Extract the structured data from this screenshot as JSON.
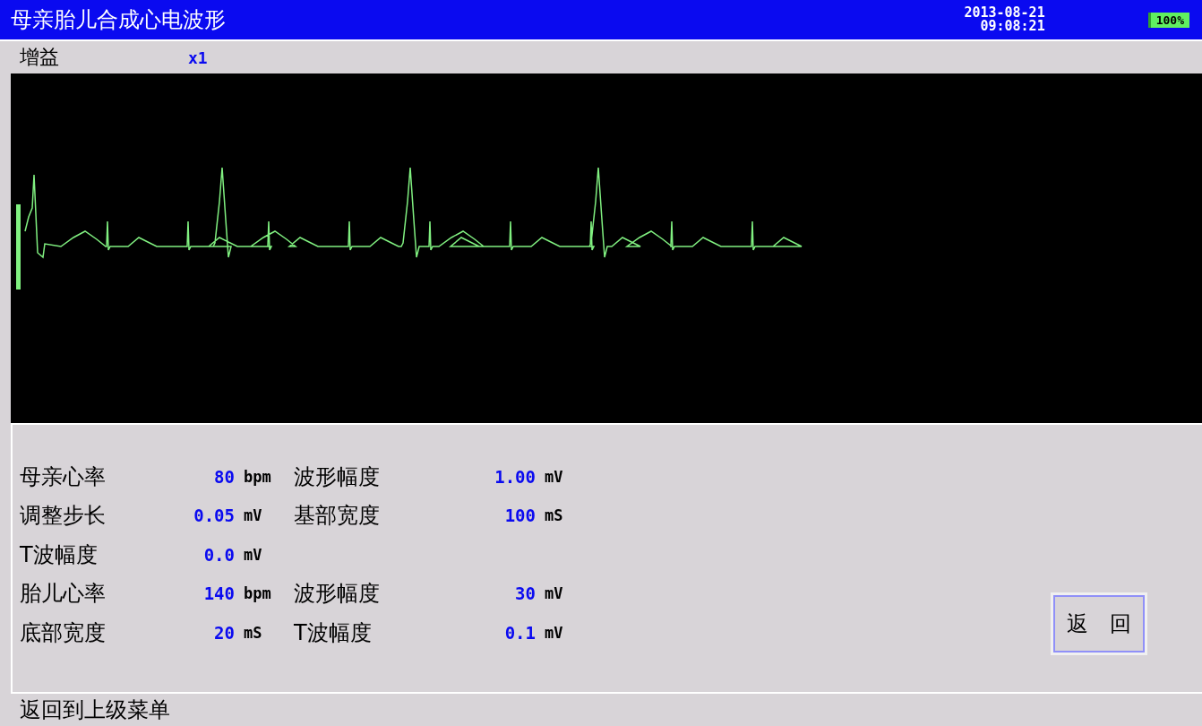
{
  "window": {
    "title": "母亲胎儿合成心电波形",
    "date": "2013-08-21",
    "time": "09:08:21",
    "battery": "100%"
  },
  "gain": {
    "label": "增益",
    "value": "x1"
  },
  "params": [
    {
      "label": "母亲心率",
      "value": "80",
      "unit": "bpm",
      "label2": "波形幅度",
      "value2": "1.00",
      "unit2": "mV"
    },
    {
      "label": "调整步长",
      "value": "0.05",
      "unit": "mV",
      "label2": "基部宽度",
      "value2": "100",
      "unit2": "mS"
    },
    {
      "label": "T波幅度",
      "value": "0.0",
      "unit": "mV"
    },
    {
      "label": "胎儿心率",
      "value": "140",
      "unit": "bpm",
      "label2": "波形幅度",
      "value2": "30",
      "unit2": "mV"
    },
    {
      "label": "底部宽度",
      "value": "20",
      "unit": "mS",
      "label2": "T波幅度",
      "value2": "0.1",
      "unit2": "mV"
    }
  ],
  "back_button": "返　回",
  "status_bar": "返回到上级菜单"
}
